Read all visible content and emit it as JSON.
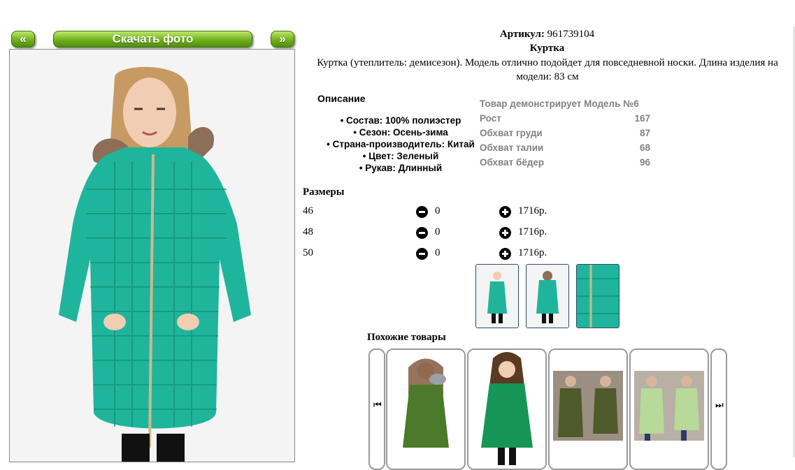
{
  "nav": {
    "prev_label": "«",
    "next_label": "»",
    "download_label": "Скачать фото"
  },
  "product": {
    "article_label": "Артикул:",
    "article_value": "961739104",
    "name": "Куртка",
    "description": "Куртка (утеплитель: демисезон). Модель отлично подойдет для повседневной носки. Длина изделия на модели: 83 см"
  },
  "details": {
    "heading": "Описание",
    "features": [
      "Состав: 100% полиэстер",
      "Сезон: Осень-зима",
      "Страна-производитель: Китай",
      "Цвет: Зеленый",
      "Рукав: Длинный"
    ]
  },
  "model": {
    "heading": "Товар демонстрирует Модель №6",
    "rows": [
      {
        "label": "Рост",
        "value": "167"
      },
      {
        "label": "Обхват груди",
        "value": "87"
      },
      {
        "label": "Обхват талии",
        "value": "68"
      },
      {
        "label": "Обхват бёдер",
        "value": "96"
      }
    ]
  },
  "sizes": {
    "heading": "Размеры",
    "rows": [
      {
        "size": "46",
        "qty": "0",
        "price": "1716р."
      },
      {
        "size": "48",
        "qty": "0",
        "price": "1716р."
      },
      {
        "size": "50",
        "qty": "0",
        "price": "1716р."
      }
    ]
  },
  "similar": {
    "heading": "Похожие товары",
    "prev_arrow": "⏮",
    "next_arrow": "⏭"
  },
  "colors": {
    "jacket": "#1fb59c",
    "button_green": "#6fb11c",
    "model_text": "#808080",
    "thumb_border": "#2b4a6f"
  }
}
